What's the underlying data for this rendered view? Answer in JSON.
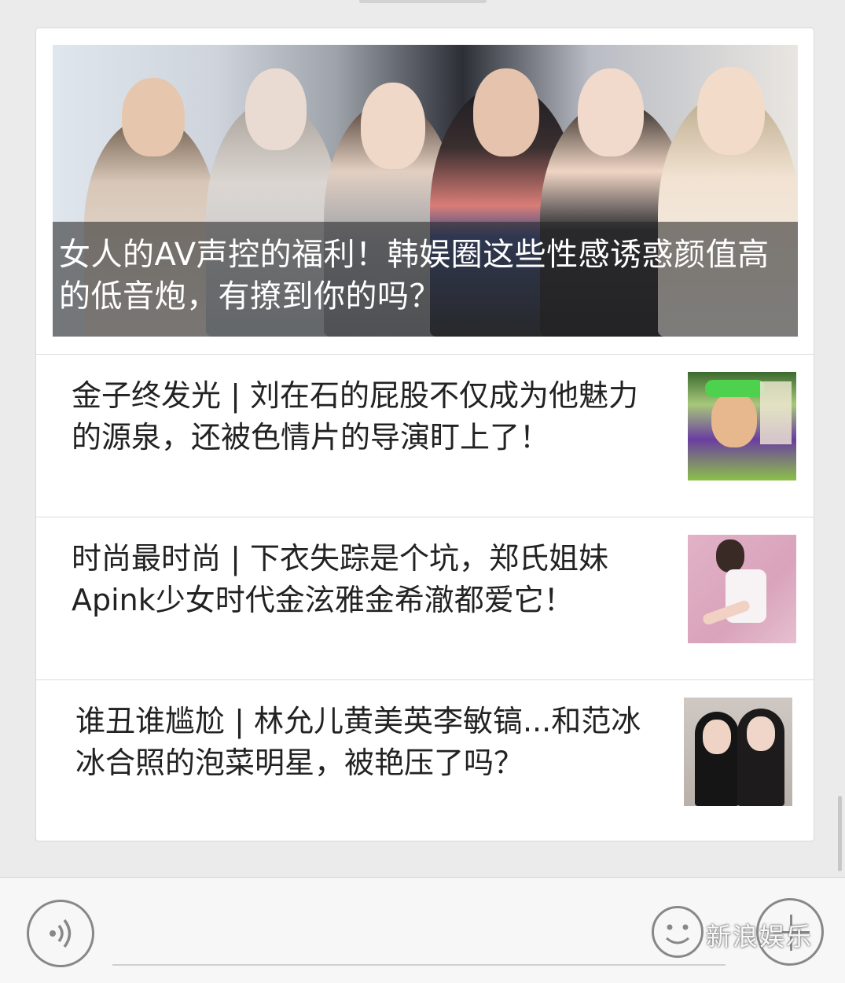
{
  "cover_article": {
    "title": "女人的AV声控的福利！韩娱圈这些性感诱惑颜值高的低音炮，有撩到你的吗？"
  },
  "articles": [
    {
      "title": "金子终发光 | 刘在石的屁股不仅成为他魅力的源泉，还被色情片的导演盯上了！",
      "thumb_icon": "variety-show-photo"
    },
    {
      "title": "时尚最时尚 | 下衣失踪是个坑，郑氏姐妹Apink少女时代金泫雅金希澈都爱它！",
      "thumb_icon": "fashion-photo"
    },
    {
      "title": "谁丑谁尴尬 | 林允儿黄美英李敏镐...和范冰冰合照的泡菜明星，被艳压了吗？",
      "thumb_icon": "group-photo"
    }
  ],
  "bottom_bar": {
    "watermark": "新浪娱乐",
    "icons": [
      "voice-icon",
      "emoji-icon",
      "plus-icon"
    ]
  }
}
